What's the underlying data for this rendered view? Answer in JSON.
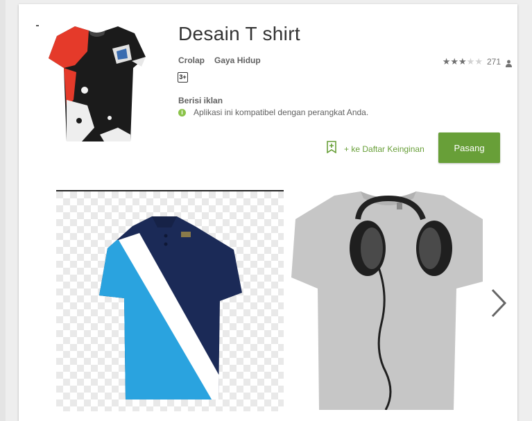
{
  "app": {
    "title": "Desain T shirt",
    "developer": "Crolap",
    "category": "Gaya Hidup",
    "content_rating": "3+",
    "rating_stars": 3,
    "rating_max": 5,
    "rating_count": "271",
    "ads_label": "Berisi iklan",
    "compatibility": "Aplikasi ini kompatibel dengan perangkat Anda."
  },
  "actions": {
    "wishlist_label": "+ ke Daftar Keinginan",
    "install_label": "Pasang"
  },
  "icons": {
    "rating_star": "star-icon",
    "reviewers": "person-icon",
    "compat": "info-icon",
    "wishlist": "bookmark-add-icon",
    "next": "chevron-right-icon"
  },
  "colors": {
    "accent": "#689f38",
    "compat_icon": "#8bc34a"
  }
}
